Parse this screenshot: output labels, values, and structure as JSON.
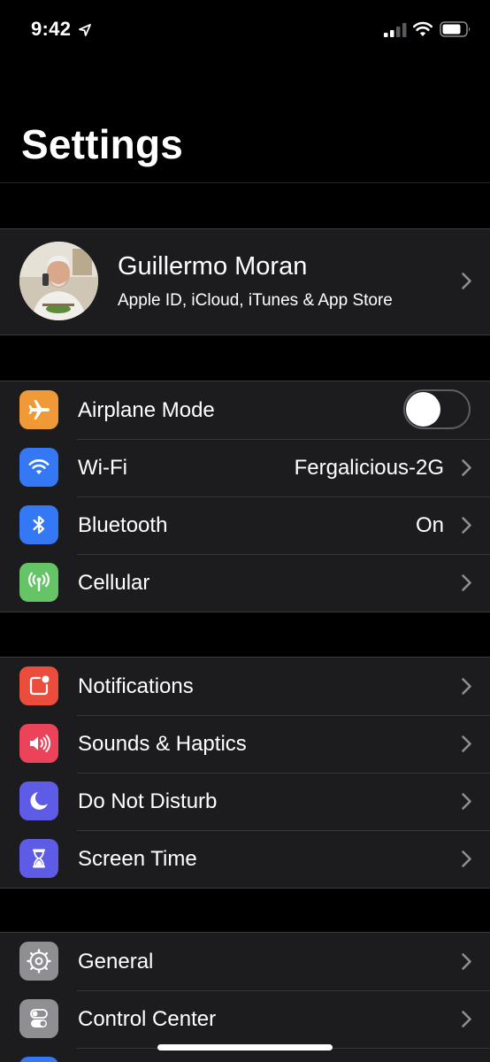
{
  "status_bar": {
    "time": "9:42",
    "icons": [
      "location-arrow-icon",
      "cellular-signal-icon",
      "wifi-icon",
      "battery-icon"
    ]
  },
  "title": "Settings",
  "profile": {
    "name": "Guillermo Moran",
    "subtitle": "Apple ID, iCloud, iTunes & App Store"
  },
  "connectivity": [
    {
      "label": "Airplane Mode",
      "icon": "airplane-icon",
      "color": "#f09a37",
      "toggle": false
    },
    {
      "label": "Wi-Fi",
      "value": "Fergalicious-2G",
      "icon": "wifi-icon",
      "color": "#3478f6"
    },
    {
      "label": "Bluetooth",
      "value": "On",
      "icon": "bluetooth-icon",
      "color": "#3478f6"
    },
    {
      "label": "Cellular",
      "icon": "cellular-antenna-icon",
      "color": "#65c466"
    }
  ],
  "alerts": [
    {
      "label": "Notifications",
      "icon": "notifications-icon",
      "color": "#eb4d3d"
    },
    {
      "label": "Sounds & Haptics",
      "icon": "speaker-icon",
      "color": "#eb445a"
    },
    {
      "label": "Do Not Disturb",
      "icon": "moon-icon",
      "color": "#5e5ce6"
    },
    {
      "label": "Screen Time",
      "icon": "hourglass-icon",
      "color": "#5e5ce6"
    }
  ],
  "general": [
    {
      "label": "General",
      "icon": "gear-icon",
      "color": "#8e8e93"
    },
    {
      "label": "Control Center",
      "icon": "switches-icon",
      "color": "#8e8e93"
    },
    {
      "label": "",
      "icon": "display-icon",
      "color": "#3478f6"
    }
  ]
}
